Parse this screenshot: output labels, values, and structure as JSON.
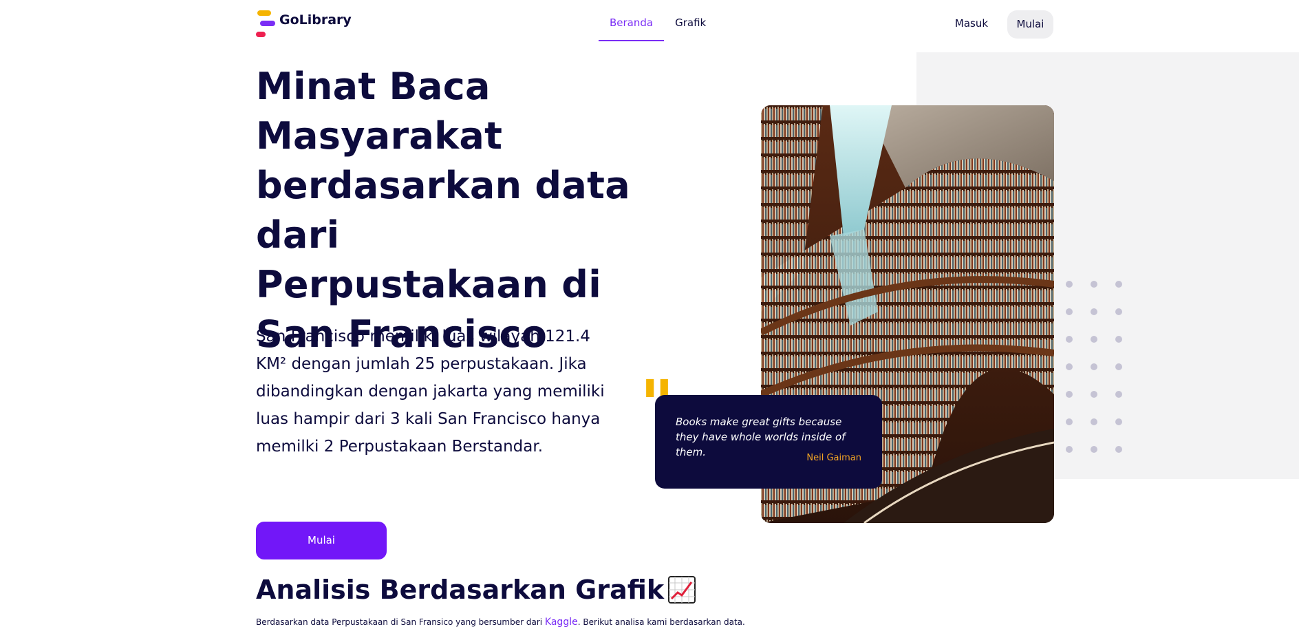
{
  "brand": {
    "name": "GoLibrary"
  },
  "nav": {
    "items": [
      {
        "label": "Beranda",
        "active": true
      },
      {
        "label": "Grafik",
        "active": false
      }
    ]
  },
  "auth": {
    "login_label": "Masuk",
    "start_label": "Mulai"
  },
  "hero": {
    "title": "Minat Baca Masyarakat berdasarkan data dari Perpustakaan di San Francisco",
    "description": "San Francisco memiliki luas wilayah 121.4 KM² dengan jumlah 25 perpustakaan. Jika dibandingkan dengan jakarta yang memiliki luas hampir dari 3 kali San Francisco hanya memilki 2 Perpustakaan Berstandar.",
    "cta_label": "Mulai"
  },
  "quote": {
    "mark": "\"",
    "text": "Books make great gifts because they have whole worlds inside of them.",
    "author": "Neil Gaiman"
  },
  "analysis": {
    "title": "Analisis Berdasarkan Grafik",
    "subtitle_before": "Berdasarkan data Perpustakaan di San Fransico yang bersumber dari ",
    "link_label": "Kaggle",
    "subtitle_after": ". Berikut analisa kami berdasarkan data."
  },
  "colors": {
    "accent": "#7a2df5",
    "button": "#7217f8",
    "navy": "#0d0b3d",
    "quote_mark": "#f5b400",
    "quote_author": "#f5a623"
  }
}
